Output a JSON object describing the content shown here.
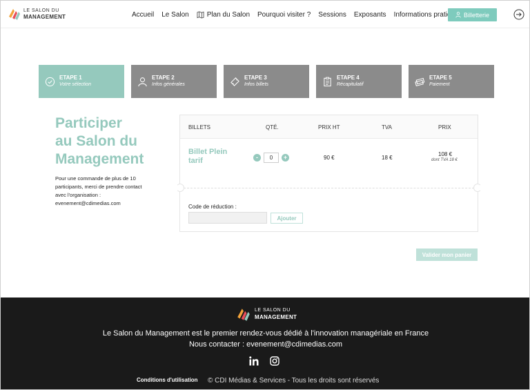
{
  "colors": {
    "accent": "#95c9bd",
    "step_inactive": "#8b8b8b",
    "footer_bg": "#1a1a1a",
    "button_blue": "#7ecbbd"
  },
  "header": {
    "logo_top": "LE SALON DU",
    "logo_bottom": "MANAGEMENT",
    "nav": [
      "Accueil",
      "Le Salon",
      "Plan du Salon",
      "Pourquoi visiter ?",
      "Sessions",
      "Exposants",
      "Informations pratiques"
    ],
    "billetterie": "Billetterie"
  },
  "steps": [
    {
      "title": "ETAPE 1",
      "sub": "Votre sélection",
      "icon": "check-circle-icon"
    },
    {
      "title": "ETAPE 2",
      "sub": "Infos générales",
      "icon": "user-icon"
    },
    {
      "title": "ETAPE 3",
      "sub": "Infos billets",
      "icon": "ticket-icon"
    },
    {
      "title": "ETAPE 4",
      "sub": "Récapitulatif",
      "icon": "clipboard-icon"
    },
    {
      "title": "ETAPE 5",
      "sub": "Paiement",
      "icon": "money-icon"
    }
  ],
  "intro": {
    "title": [
      "Participer",
      "au Salon du",
      "Management"
    ],
    "text": [
      "Pour une commande de plus de 10",
      "participants, merci de prendre contact",
      "avec l'organisation :",
      "evenement@cdimedias.com"
    ]
  },
  "cart": {
    "headers": {
      "billets": "BILLETS",
      "qte": "QTÉ.",
      "ht": "PRIX HT",
      "tva": "TVA",
      "prix": "PRIX"
    },
    "ticket_name": "Billet Plein tarif",
    "quantity": "0",
    "minus": "-",
    "plus": "+",
    "price_ht": "90 €",
    "tva": "18 €",
    "price": "108 €",
    "price_note": "dont TVA 18 €",
    "promo_label": "Code de réduction :",
    "promo_value": "",
    "promo_button": "Ajouter"
  },
  "validate_button": "Valider mon panier",
  "footer": {
    "logo_top": "LE SALON DU",
    "logo_bottom": "MANAGEMENT",
    "tagline": "Le Salon du Management est le premier rendez-vous dédié à l'innovation managériale en France",
    "contact": "Nous contacter : evenement@cdimedias.com",
    "conditions": "Conditions d'utilisation",
    "copyright": "© CDI Médias & Services - Tous les droits sont réservés"
  }
}
